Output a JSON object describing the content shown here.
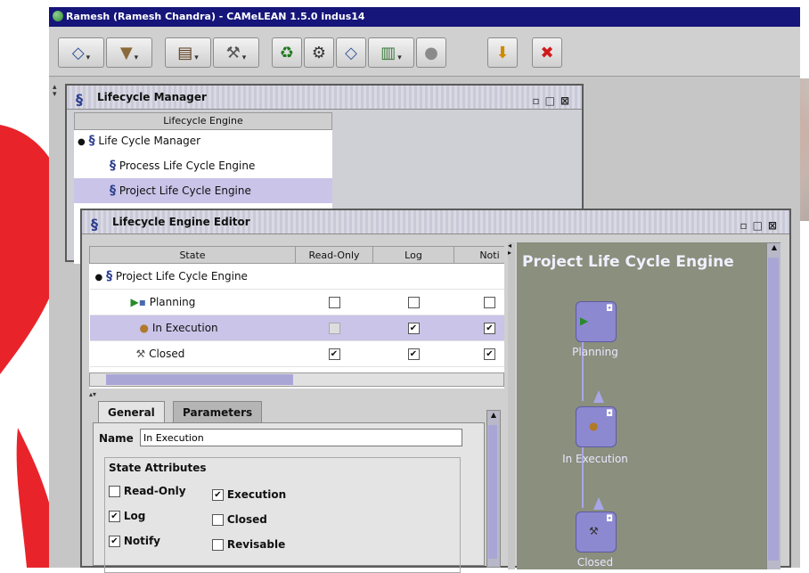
{
  "window": {
    "title": "Ramesh (Ramesh Chandra) - CAMeLEAN 1.5.0 indus14"
  },
  "toolbar": {
    "buttons": [
      {
        "name": "process-icon",
        "glyph": "◇",
        "dropdown": true
      },
      {
        "name": "filter-icon",
        "glyph": "▼",
        "dropdown": true
      },
      {
        "name": "books-icon",
        "glyph": "▤",
        "dropdown": true
      },
      {
        "name": "tools-icon",
        "glyph": "⚒",
        "dropdown": true
      },
      {
        "name": "recycle-icon",
        "glyph": "♻",
        "dropdown": false
      },
      {
        "name": "network-icon",
        "glyph": "⚙",
        "dropdown": false
      },
      {
        "name": "tag-icon",
        "glyph": "◇",
        "dropdown": false
      },
      {
        "name": "chart-icon",
        "glyph": "▥",
        "dropdown": true
      },
      {
        "name": "disabled-icon",
        "glyph": "●",
        "dropdown": false
      },
      {
        "name": "arrow-down-icon",
        "glyph": "⬇",
        "dropdown": false
      },
      {
        "name": "stop-icon",
        "glyph": "✖",
        "dropdown": false
      }
    ]
  },
  "lifecycle_manager": {
    "title": "Lifecycle Manager",
    "column_header": "Lifecycle Engine",
    "tree": [
      {
        "label": "Life Cycle Manager",
        "level": 0,
        "selected": false
      },
      {
        "label": "Process Life Cycle Engine",
        "level": 1,
        "selected": false
      },
      {
        "label": "Project Life Cycle Engine",
        "level": 1,
        "selected": true
      }
    ]
  },
  "editor": {
    "title": "Lifecycle Engine Editor",
    "columns": [
      "State",
      "Read-Only",
      "Log",
      "Noti"
    ],
    "rows": [
      {
        "label": "Project Life Cycle Engine",
        "level": 0,
        "readonly": null,
        "log": null,
        "notify": null,
        "selected": false
      },
      {
        "label": "Planning",
        "level": 1,
        "readonly": false,
        "log": false,
        "notify": false,
        "selected": false
      },
      {
        "label": "In Execution",
        "level": 1,
        "readonly": false,
        "log": true,
        "notify": true,
        "selected": true
      },
      {
        "label": "Closed",
        "level": 1,
        "readonly": true,
        "log": true,
        "notify": true,
        "selected": false
      }
    ],
    "tabs": [
      "General",
      "Parameters"
    ],
    "name_label": "Name",
    "name_value": "In Execution",
    "attributes_title": "State Attributes",
    "attributes": [
      {
        "label": "Read-Only",
        "checked": false
      },
      {
        "label": "Execution",
        "checked": true
      },
      {
        "label": "Log",
        "checked": true
      },
      {
        "label": "Closed",
        "checked": false
      },
      {
        "label": "Notify",
        "checked": true
      },
      {
        "label": "Revisable",
        "checked": false
      }
    ],
    "diagram": {
      "title": "Project Life Cycle Engine",
      "nodes": [
        {
          "label": "Planning"
        },
        {
          "label": "In Execution"
        },
        {
          "label": "Closed"
        }
      ]
    }
  },
  "colors": {
    "titlebar": "#15157a",
    "selection": "#c9c4e8",
    "diagram_bg": "#8a8f7e",
    "node": "#8d89d0",
    "swoosh": "#e8242a"
  }
}
